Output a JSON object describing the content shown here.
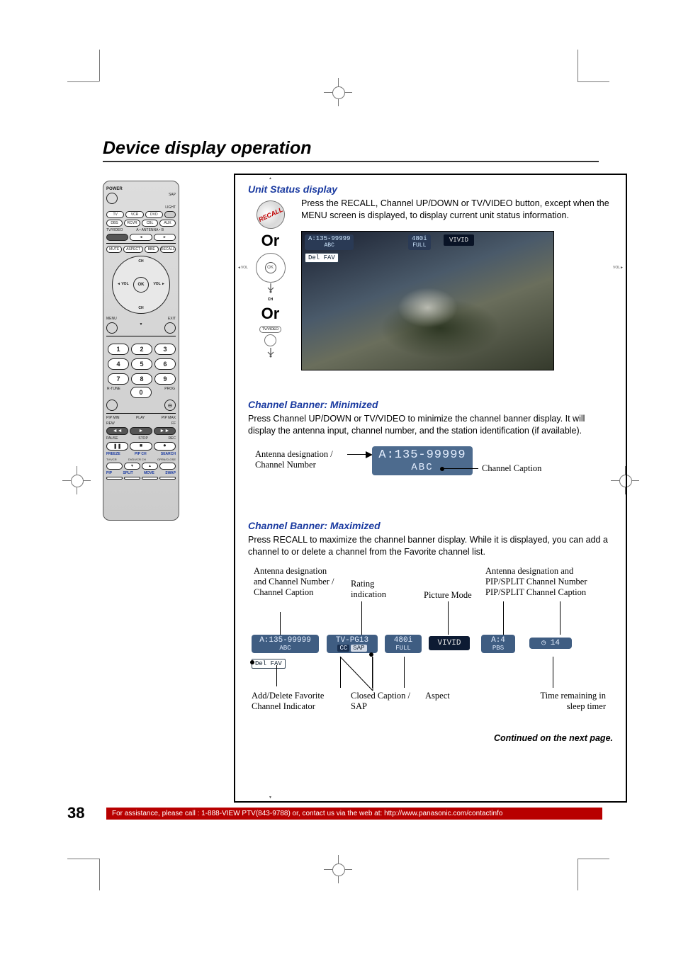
{
  "page": {
    "number": "38",
    "title": "Device display operation",
    "footer": "For assistance, please call : 1-888-VIEW PTV(843-9788) or, contact us via the web at: http://www.panasonic.com/contactinfo",
    "continued": "Continued on the next page."
  },
  "remote": {
    "power": "POWER",
    "sap_top": "SAP",
    "light": "LIGHT",
    "row1": [
      "TV",
      "VCR",
      "DVD"
    ],
    "row2": [
      "DBS",
      "RCVR",
      "CBL",
      "AUX"
    ],
    "tvvideo": "TV/VIDEO",
    "antenna": "A • ANTENNA • B",
    "mute": "MUTE",
    "aspect": "ASPECT",
    "bbe": "BBE",
    "recall": "RECALL",
    "ch": "CH",
    "vol": "VOL",
    "ok": "OK",
    "menu": "MENU",
    "exit": "EXIT",
    "numbers": [
      "1",
      "2",
      "3",
      "4",
      "5",
      "6",
      "7",
      "8",
      "9",
      "0"
    ],
    "rtune": "R-TUNE",
    "prog": "PROG",
    "pip_min": "PIP MIN",
    "play": "PLAY",
    "pip_max": "PIP MAX",
    "rew": "REW",
    "ff": "FF",
    "pause": "PAUSE",
    "stop": "STOP",
    "rec": "REC",
    "freeze": "FREEZE",
    "tvvcr": "TV/VCR",
    "pipch": "PIP CH",
    "dvdvcrch": "DVD/VCR CH",
    "search": "SEARCH",
    "opencl": "OPEN/CLOSE",
    "pip": "PIP",
    "split": "SPLIT",
    "move": "MOVE",
    "swap": "SWAP"
  },
  "unit_status": {
    "heading": "Unit Status display",
    "text": "Press the RECALL, Channel UP/DOWN or TV/VIDEO button, except when the MENU screen is displayed, to display current unit status information.",
    "recall": "RECALL",
    "or": "Or",
    "ok": "OK",
    "vol": "VOL",
    "ch": "CH",
    "tvvideo": "TV/VIDEO",
    "osd": {
      "ch": "A:135-99999",
      "cap": "ABC",
      "res": "480i",
      "aspect": "FULL",
      "mode": "VIVID",
      "delfav": "Del FAV"
    }
  },
  "min": {
    "heading": "Channel Banner: Minimized",
    "text": "Press Channel UP/DOWN or TV/VIDEO to minimize the channel banner display. It will display the antenna input, channel number, and the station identification (if available).",
    "banner": {
      "line1": "A:135-99999",
      "line2": "ABC"
    },
    "callout_left": "Antenna designation / Channel Number",
    "callout_right": "Channel Caption"
  },
  "max": {
    "heading": "Channel Banner: Maximized",
    "text": "Press RECALL to maximize the channel banner display. While it is displayed, you can add a channel to or delete a channel from the Favorite channel list.",
    "top_callouts": {
      "ch": "Antenna designation and Channel Number / Channel Caption",
      "rating": "Rating indication",
      "picture": "Picture Mode",
      "pip": "Antenna designation and PIP/SPLIT Channel Number PIP/SPLIT Channel Caption"
    },
    "osd": {
      "ch": "A:135-99999",
      "cap": "ABC",
      "rating": "TV-PG13",
      "cc": "CC",
      "sap": "SAP",
      "res": "480i",
      "aspect": "FULL",
      "mode": "VIVID",
      "pip_ch": "A:4",
      "pip_cap": "PBS",
      "sleep": "14",
      "delfav": "Del FAV"
    },
    "bottom_callouts": {
      "fav": "Add/Delete Favorite Channel Indicator",
      "cc": "Closed Caption / SAP",
      "aspect": "Aspect",
      "sleep": "Time remaining in sleep timer"
    }
  }
}
